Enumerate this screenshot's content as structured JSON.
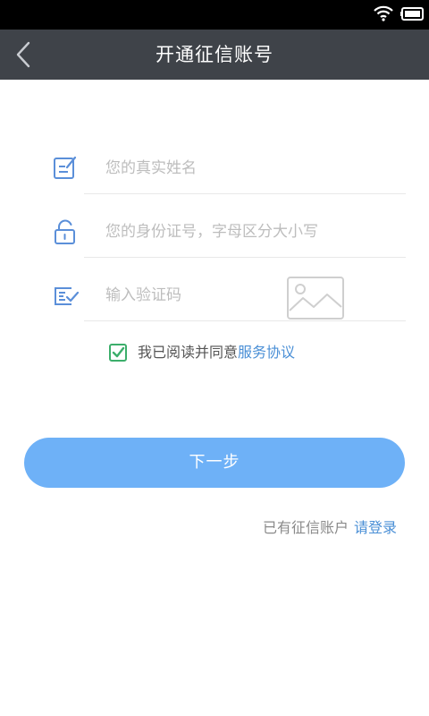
{
  "nav": {
    "title": "开通征信账号"
  },
  "form": {
    "name_placeholder": "您的真实姓名",
    "id_placeholder": "您的身份证号，字母区分大小写",
    "code_placeholder": "输入验证码"
  },
  "agreement": {
    "checked": true,
    "text": "我已阅读并同意",
    "link": "服务协议"
  },
  "next_button": "下一步",
  "login": {
    "prompt": "已有征信账户",
    "link": "请登录"
  },
  "colors": {
    "nav_bg": "#3f4349",
    "accent": "#6eb1f7",
    "link": "#4a8fd6",
    "check": "#3cae6b"
  }
}
